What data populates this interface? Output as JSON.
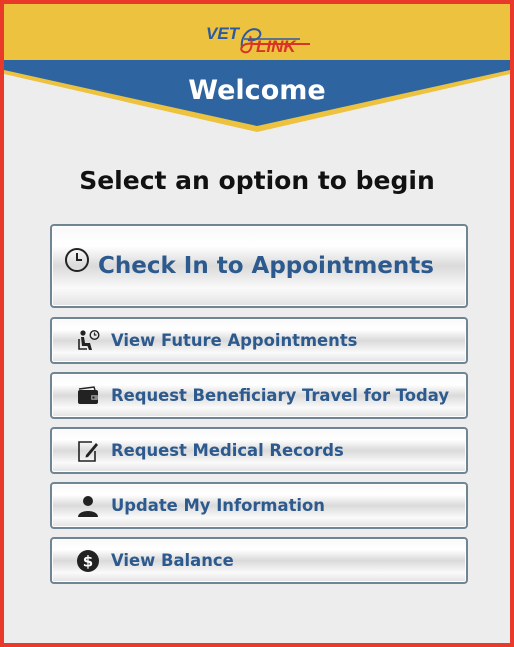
{
  "header": {
    "logo": "VET LINK",
    "title": "Welcome",
    "colors": {
      "gold": "#ecc23e",
      "blue": "#2e65a0",
      "logo_blue": "#2c5aa0",
      "logo_red": "#d83428"
    }
  },
  "main": {
    "subtitle": "Select an option to begin",
    "primary_button": {
      "label": "Check In to Appointments",
      "icon": "clock-icon"
    },
    "buttons": [
      {
        "label": "View Future Appointments",
        "icon": "waiting-room-icon"
      },
      {
        "label": "Request Beneficiary Travel for Today",
        "icon": "wallet-icon"
      },
      {
        "label": "Request Medical Records",
        "icon": "edit-document-icon"
      },
      {
        "label": "Update My Information",
        "icon": "user-icon"
      },
      {
        "label": "View Balance",
        "icon": "dollar-icon"
      }
    ],
    "colors": {
      "button_text": "#2d5a8e",
      "button_border": "#6f8593",
      "frame": "#e8392a"
    }
  }
}
